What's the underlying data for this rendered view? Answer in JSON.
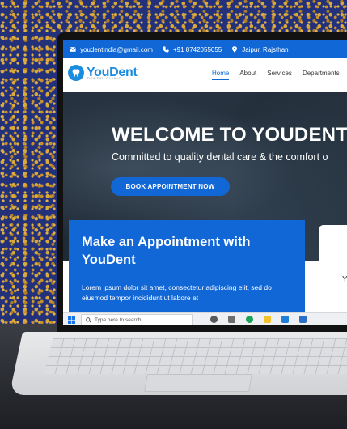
{
  "topbar": {
    "email": "youdentindia@gmail.com",
    "phone": "+91 8742055055",
    "location": "Jaipur, Rajsthan"
  },
  "brand": {
    "name": "YouDent",
    "tagline": "DENTAL CLINIC"
  },
  "nav": {
    "items": [
      "Home",
      "About",
      "Services",
      "Departments"
    ],
    "active": "Home"
  },
  "hero": {
    "title": "WELCOME TO YOUDENT",
    "subtitle": "Committed to quality dental care & the comfort o",
    "button_label": "BOOK APPOINTMENT NOW"
  },
  "appointment": {
    "title": "Make an Appointment with YouDent",
    "text": "Lorem ipsum dolor sit amet, consectetur adipiscing elit, sed do eiusmod tempor incididunt ut labore et"
  },
  "side_panel": {
    "text": "Y"
  },
  "taskbar": {
    "search_placeholder": "Type here to search"
  },
  "colors": {
    "primary": "#1167d6",
    "logo": "#1b8de0",
    "wallpaper": "#23317a",
    "accent_gold": "#d9a93a"
  },
  "icons": [
    "email-icon",
    "phone-icon",
    "location-icon",
    "tooth-logo-icon",
    "windows-icon",
    "search-icon"
  ]
}
